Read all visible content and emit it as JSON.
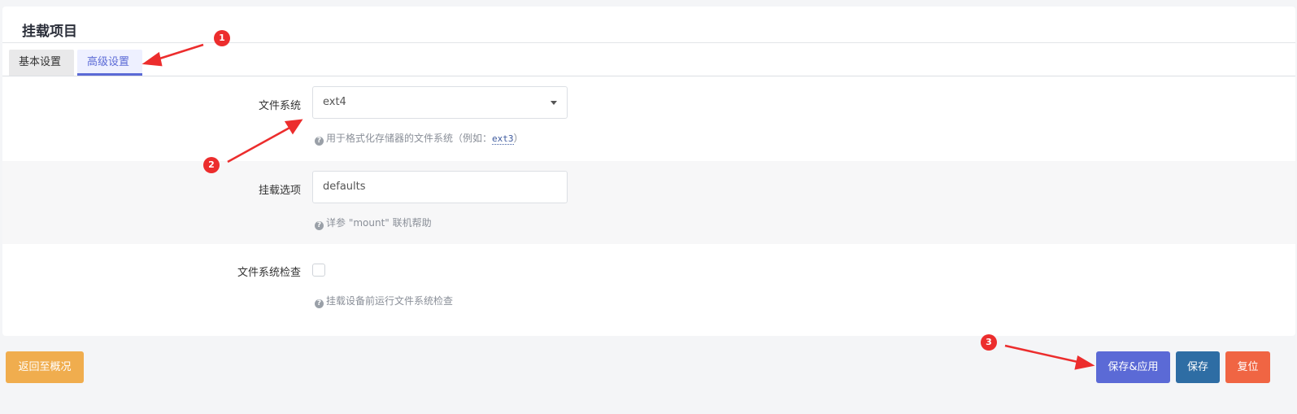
{
  "panel": {
    "title": "挂载项目"
  },
  "tabs": [
    {
      "label": "基本设置",
      "active": false
    },
    {
      "label": "高级设置",
      "active": true
    }
  ],
  "form": {
    "filesystem": {
      "label": "文件系统",
      "value": "ext4",
      "hint_prefix": "用于格式化存储器的文件系统（例如：",
      "hint_code": "ext3",
      "hint_suffix": "）"
    },
    "mount_options": {
      "label": "挂载选项",
      "value": "defaults",
      "hint": "详参 \"mount\" 联机帮助"
    },
    "fs_check": {
      "label": "文件系统检查",
      "checked": false,
      "hint": "挂载设备前运行文件系统检查"
    }
  },
  "buttons": {
    "back": "返回至概况",
    "save_apply": "保存&应用",
    "save": "保存",
    "reset": "复位"
  },
  "annotations": [
    "1",
    "2",
    "3"
  ],
  "colors": {
    "accent": "#5b6ad6",
    "back": "#f0ad4e",
    "save": "#2e6da4",
    "reset": "#f06543",
    "annotation": "#ec2d2d"
  }
}
